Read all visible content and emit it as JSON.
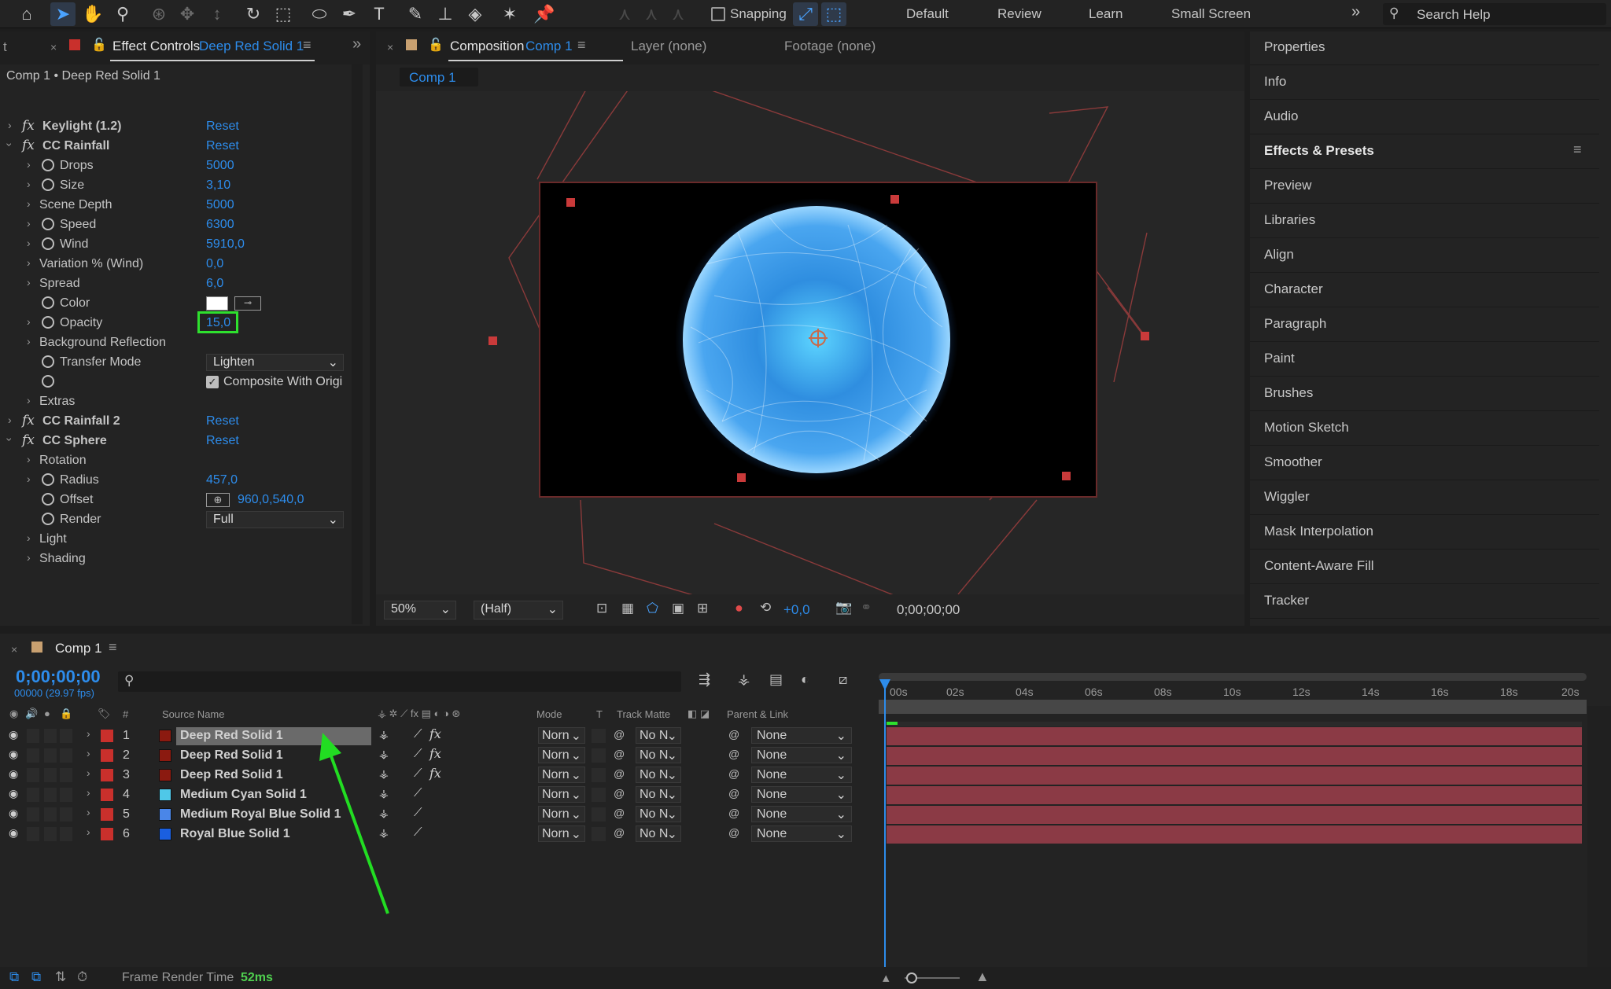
{
  "toolbar": {
    "snapping_label": "Snapping",
    "workspaces": [
      "Default",
      "Review",
      "Learn",
      "Small Screen"
    ],
    "search_placeholder": "Search Help"
  },
  "effect_controls": {
    "tab_label": "Effect Controls",
    "tab_layer": "Deep Red Solid 1",
    "left_stub": "t",
    "header": "Comp 1 • Deep Red Solid 1",
    "reset": "Reset",
    "keylight": "Keylight (1.2)",
    "cc_rainfall": "CC Rainfall",
    "drops_label": "Drops",
    "drops_value": "5000",
    "size_label": "Size",
    "size_value": "3,10",
    "scene_depth_label": "Scene Depth",
    "scene_depth_value": "5000",
    "speed_label": "Speed",
    "speed_value": "6300",
    "wind_label": "Wind",
    "wind_value": "5910,0",
    "variation_label": "Variation % (Wind)",
    "variation_value": "0,0",
    "spread_label": "Spread",
    "spread_value": "6,0",
    "color_label": "Color",
    "opacity_label": "Opacity",
    "opacity_value": "15,0",
    "bg_reflection_label": "Background Reflection",
    "transfer_mode_label": "Transfer Mode",
    "transfer_mode_value": "Lighten",
    "composite_label": "Composite With Origi",
    "extras_label": "Extras",
    "cc_rainfall_2": "CC Rainfall 2",
    "cc_sphere": "CC Sphere",
    "rotation_label": "Rotation",
    "radius_label": "Radius",
    "radius_value": "457,0",
    "offset_label": "Offset",
    "offset_value": "960,0,540,0",
    "render_label": "Render",
    "render_value": "Full",
    "light_label": "Light",
    "shading_label": "Shading"
  },
  "composition": {
    "tab_label": "Composition",
    "tab_comp": "Comp 1",
    "layer_tab": "Layer (none)",
    "footage_tab": "Footage (none)",
    "comp_chip": "Comp 1",
    "zoom": "50%",
    "resolution": "(Half)",
    "exposure": "+0,0",
    "timecode": "0;00;00;00"
  },
  "right_panel": {
    "items": [
      "Properties",
      "Info",
      "Audio",
      "Effects & Presets",
      "Preview",
      "Libraries",
      "Align",
      "Character",
      "Paragraph",
      "Paint",
      "Brushes",
      "Motion Sketch",
      "Smoother",
      "Wiggler",
      "Mask Interpolation",
      "Content-Aware Fill",
      "Tracker"
    ]
  },
  "timeline": {
    "tab_label": "Comp 1",
    "timecode": "0;00;00;00",
    "frame_info": "00000 (29.97 fps)",
    "ruler": [
      "00s",
      "02s",
      "04s",
      "06s",
      "08s",
      "10s",
      "12s",
      "14s",
      "16s",
      "18s",
      "20s"
    ],
    "columns": {
      "hash": "#",
      "source_name": "Source Name",
      "mode": "Mode",
      "t": "T",
      "track_matte": "Track Matte",
      "parent_link": "Parent & Link"
    },
    "layers": [
      {
        "num": "1",
        "name": "Deep Red Solid 1",
        "color": "#8b1a10",
        "mode": "Norn",
        "matte": "No N",
        "parent": "None"
      },
      {
        "num": "2",
        "name": "Deep Red Solid 1",
        "color": "#8b1a10",
        "mode": "Norn",
        "matte": "No N",
        "parent": "None"
      },
      {
        "num": "3",
        "name": "Deep Red Solid 1",
        "color": "#8b1a10",
        "mode": "Norn",
        "matte": "No N",
        "parent": "None"
      },
      {
        "num": "4",
        "name": "Medium Cyan Solid 1",
        "color": "#4fc8e8",
        "mode": "Norn",
        "matte": "No N",
        "parent": "None"
      },
      {
        "num": "5",
        "name": "Medium Royal Blue Solid 1",
        "color": "#4a86e8",
        "mode": "Norn",
        "matte": "No N",
        "parent": "None"
      },
      {
        "num": "6",
        "name": "Royal Blue Solid 1",
        "color": "#1a5fe0",
        "mode": "Norn",
        "matte": "No N",
        "parent": "None"
      }
    ]
  },
  "status": {
    "frame_render_label": "Frame Render Time",
    "frame_render_value": "52ms"
  },
  "colors": {
    "accent": "#2d8ceb",
    "highlight_box": "#2ee02e",
    "arrow": "#22dd22",
    "layer_bar": "#8b3a45",
    "label_red": "#c9302c"
  }
}
